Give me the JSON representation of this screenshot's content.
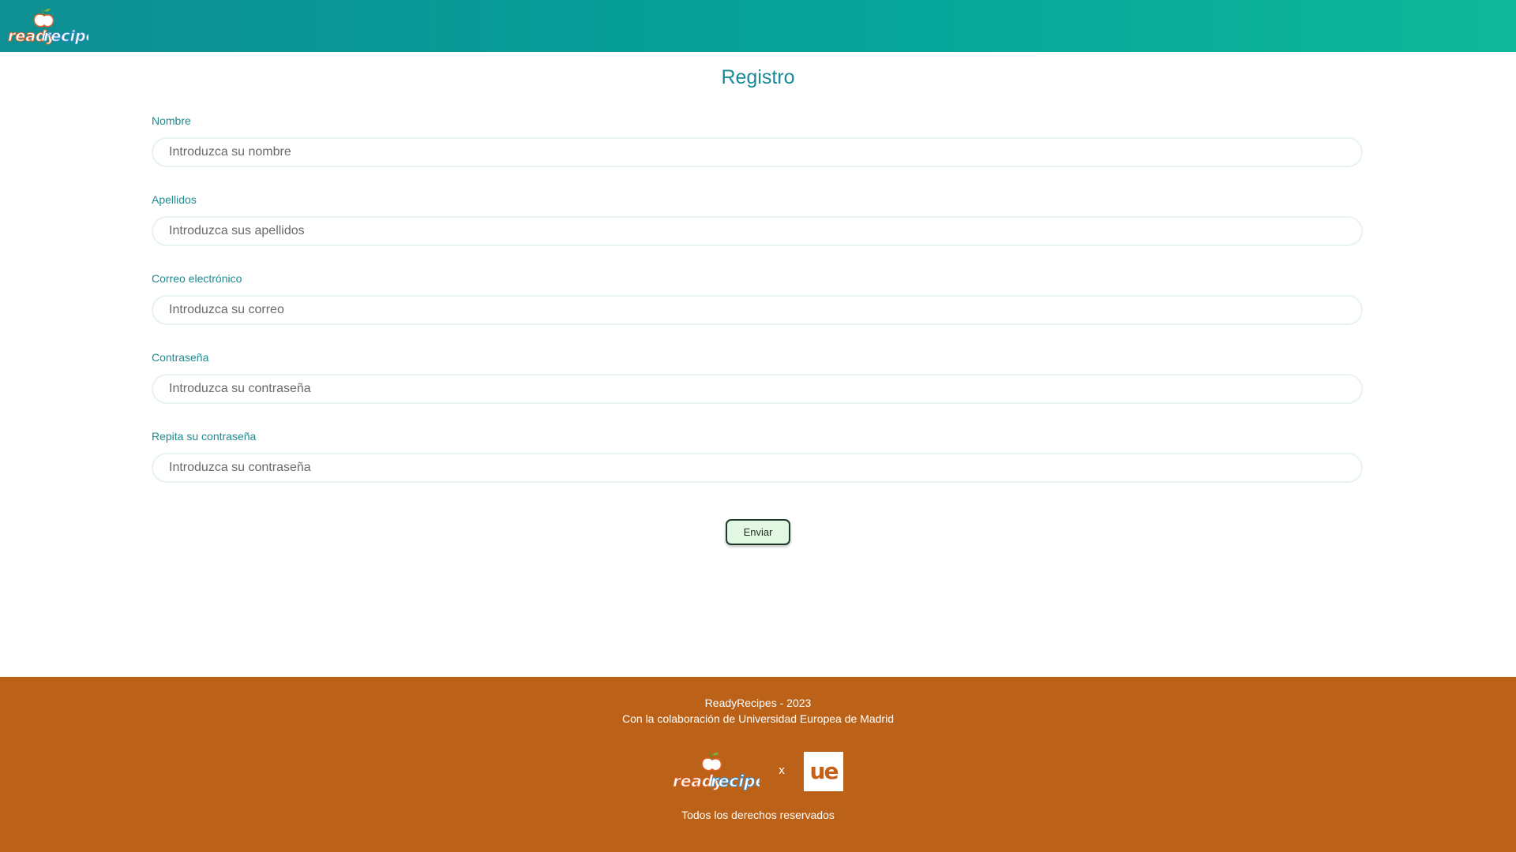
{
  "header": {
    "logo_text_ready": "ready",
    "logo_text_recipes": "recipes"
  },
  "page_title": "Registro",
  "form": {
    "fields": [
      {
        "label": "Nombre",
        "placeholder": "Introduzca su nombre",
        "value": ""
      },
      {
        "label": "Apellidos",
        "placeholder": "Introduzca sus apellidos",
        "value": ""
      },
      {
        "label": "Correo electrónico",
        "placeholder": "Introduzca su correo",
        "value": ""
      },
      {
        "label": "Contraseña",
        "placeholder": "Introduzca su contraseña",
        "value": ""
      },
      {
        "label": "Repita su contraseña",
        "placeholder": "Introduzca su contraseña",
        "value": ""
      }
    ],
    "submit_label": "Enviar"
  },
  "footer": {
    "line1": "ReadyRecipes - 2023",
    "line2": "Con la colaboración de Universidad Europea de Madrid",
    "separator": "x",
    "partner_logo_text": "ue",
    "rights": "Todos los derechos reservados"
  },
  "colors": {
    "header_gradient_start": "#0e8f93",
    "header_gradient_end": "#0fb899",
    "accent_teal": "#178b95",
    "footer_bg": "#bb6218",
    "logo_orange": "#e0632b",
    "logo_blue": "#3a8fd0",
    "ue_orange": "#c65f19",
    "button_bg": "#e3f8e3"
  },
  "icons": {
    "brand_logo": "peach-fruit-icon",
    "partner_logo": "ue-logo-icon"
  }
}
